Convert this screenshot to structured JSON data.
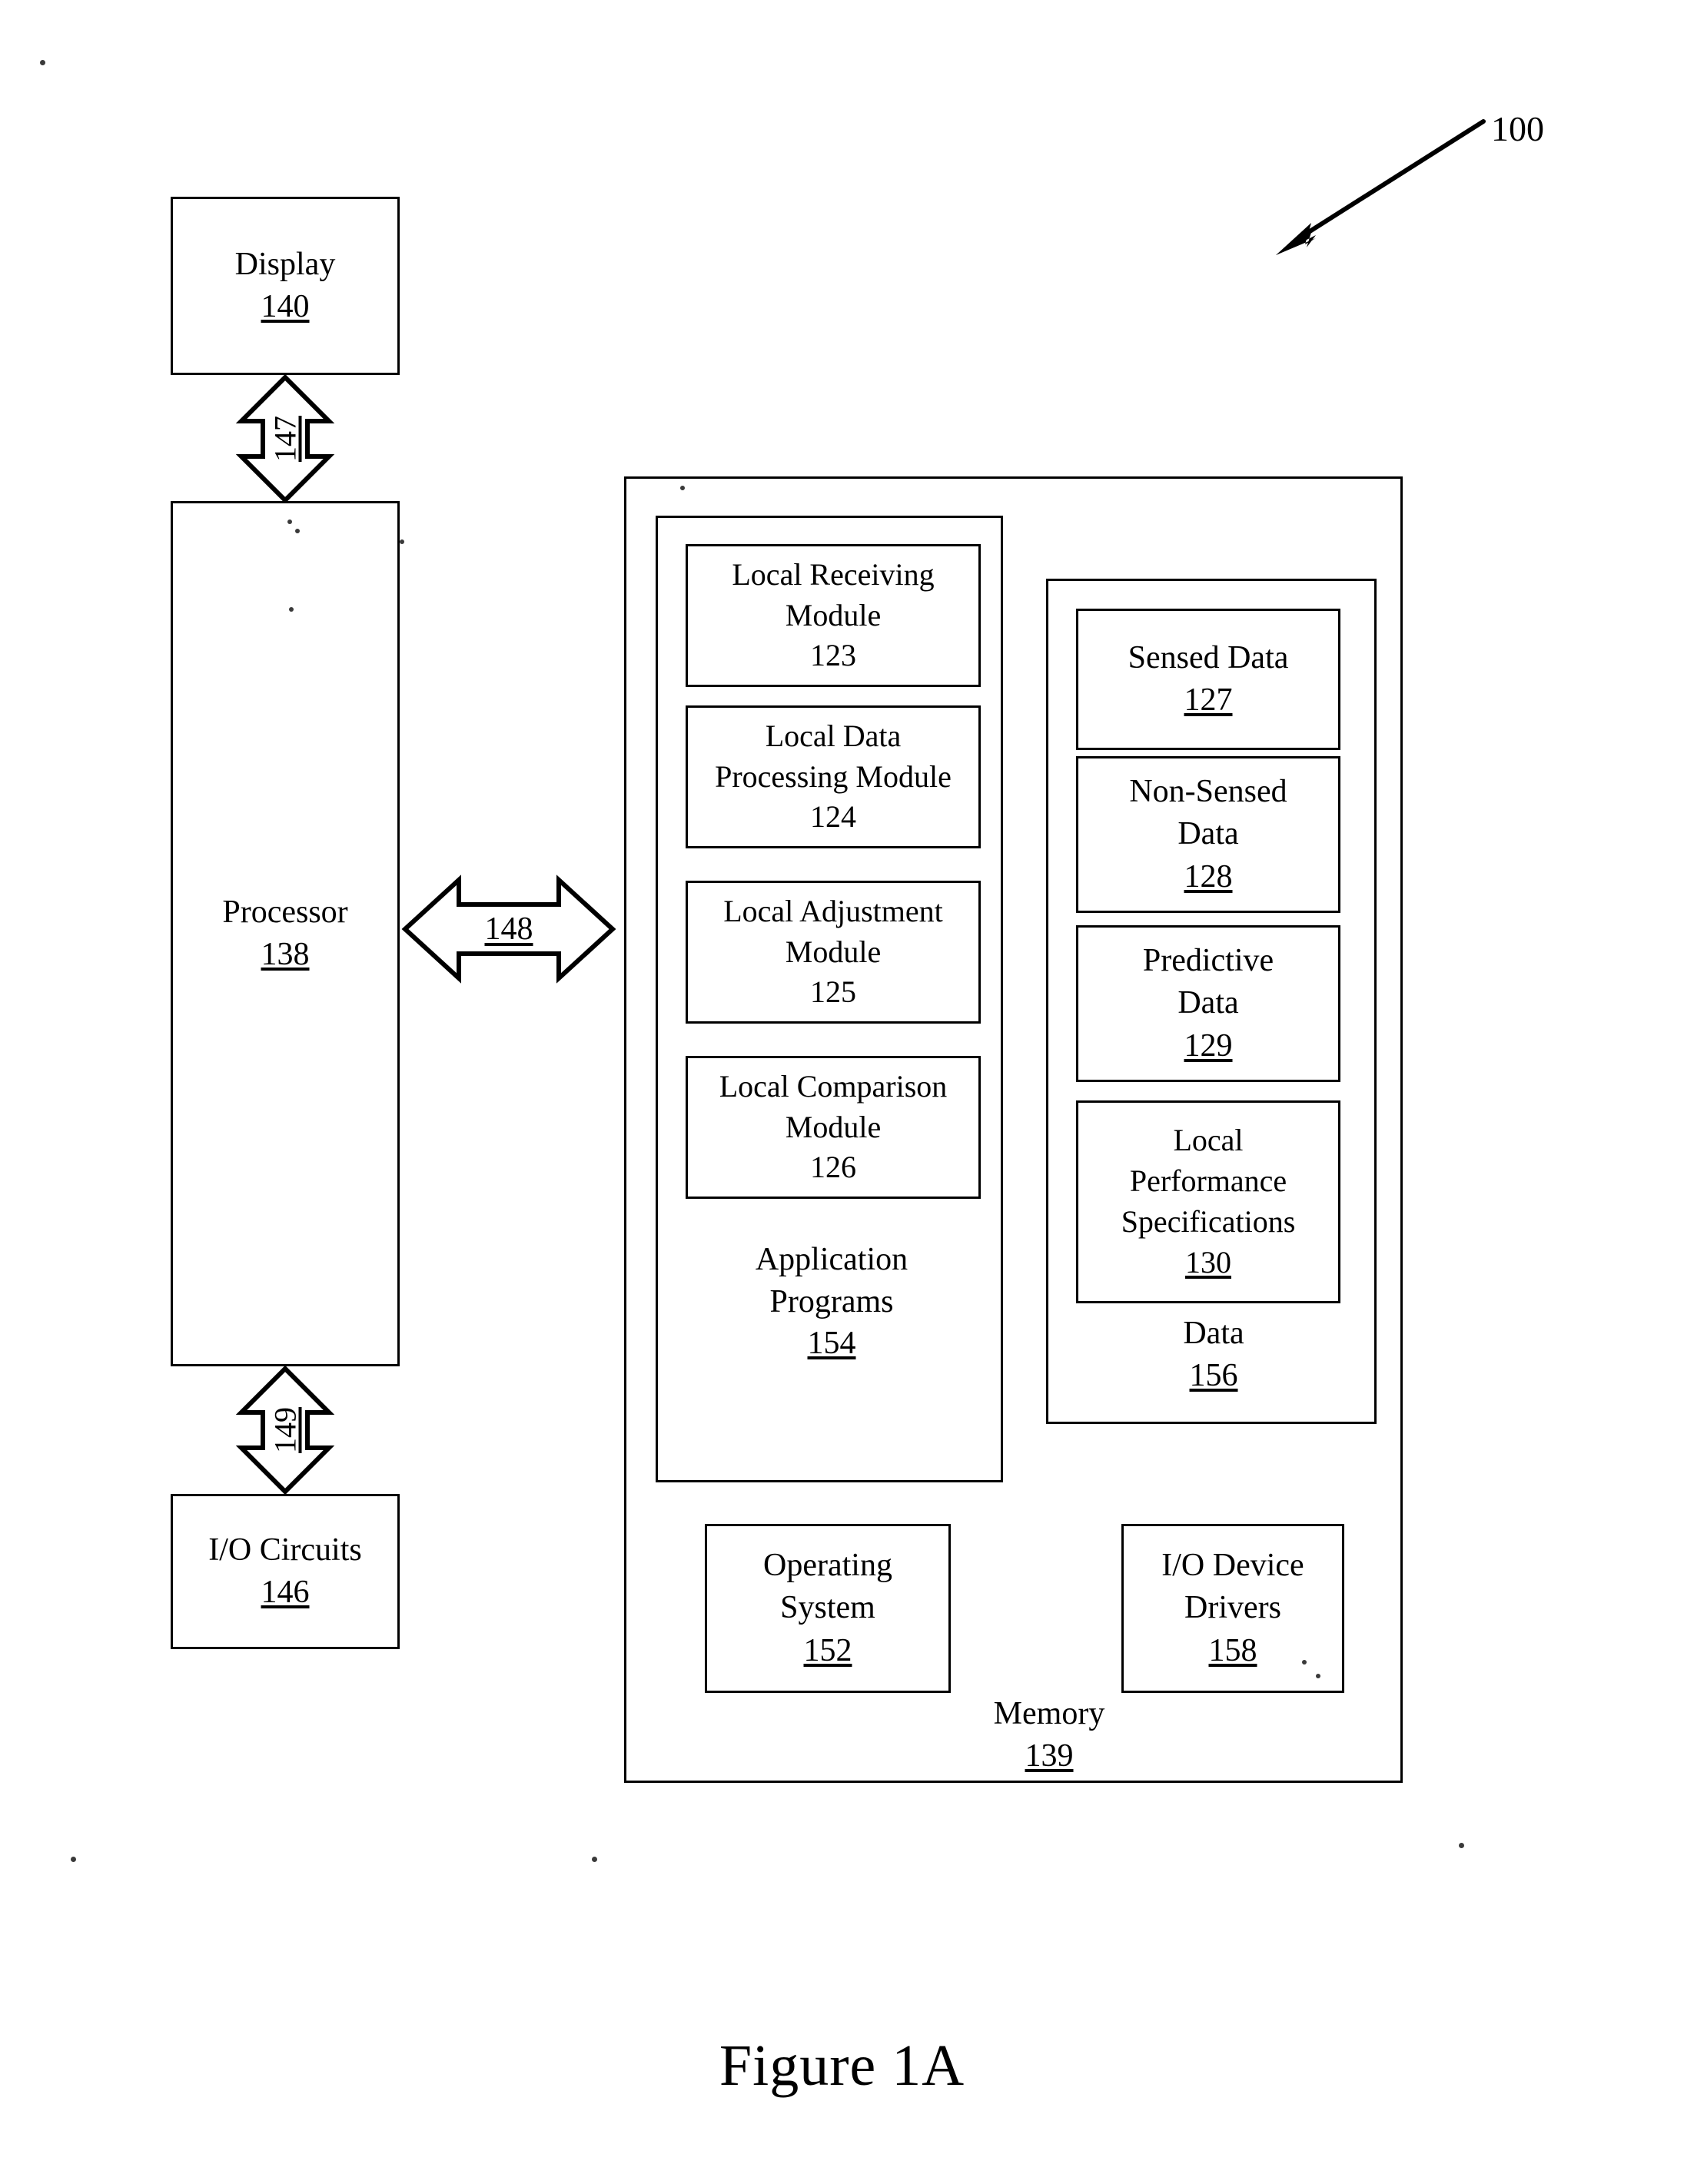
{
  "figure": {
    "caption": "Figure 1A",
    "system_ref": "100"
  },
  "left_column": {
    "display": {
      "title": "Display",
      "ref": "140"
    },
    "processor": {
      "title": "Processor",
      "ref": "138"
    },
    "io_circuits": {
      "title": "I/O Circuits",
      "ref": "146"
    }
  },
  "connections": {
    "display_processor": "147",
    "processor_memory": "148",
    "processor_io": "149"
  },
  "memory": {
    "title": "Memory",
    "ref": "139",
    "application_programs": {
      "title_line1": "Application",
      "title_line2": "Programs",
      "ref": "154",
      "modules": [
        {
          "line1": "Local Receiving",
          "line2": "Module",
          "ref": "123"
        },
        {
          "line1": "Local Data",
          "line2": "Processing Module",
          "ref": "124"
        },
        {
          "line1": "Local Adjustment",
          "line2": "Module",
          "ref": "125"
        },
        {
          "line1": "Local Comparison",
          "line2": "Module",
          "ref": "126"
        }
      ]
    },
    "data": {
      "title": "Data",
      "ref": "156",
      "items": [
        {
          "line1": "Sensed Data",
          "line2": "",
          "line3": "",
          "ref": "127"
        },
        {
          "line1": "Non-Sensed",
          "line2": "Data",
          "line3": "",
          "ref": "128"
        },
        {
          "line1": "Predictive",
          "line2": "Data",
          "line3": "",
          "ref": "129"
        },
        {
          "line1": "Local",
          "line2": "Performance",
          "line3": "Specifications",
          "ref": "130"
        }
      ]
    },
    "operating_system": {
      "line1": "Operating",
      "line2": "System",
      "ref": "152"
    },
    "io_device_drivers": {
      "line1": "I/O Device",
      "line2": "Drivers",
      "ref": "158"
    }
  }
}
